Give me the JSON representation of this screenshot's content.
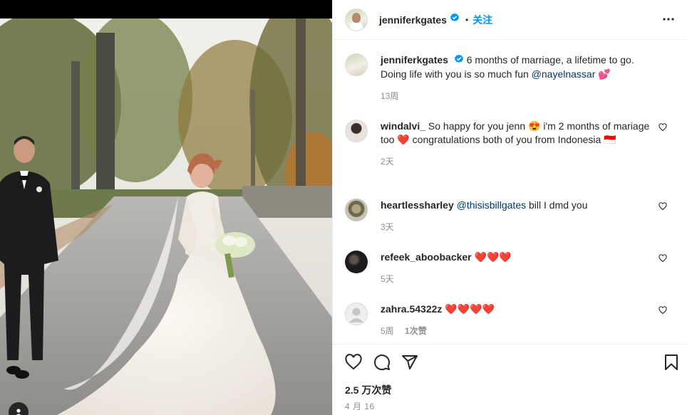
{
  "header": {
    "username": "jenniferkgates",
    "separator": "•",
    "follow_label": "关注"
  },
  "caption": {
    "username": "jenniferkgates",
    "text": "6 months of marriage, a lifetime to go. Doing life with you is so much fun ",
    "mention": "@nayelnassar",
    "emoji": "💕",
    "time": "13周"
  },
  "comments": [
    {
      "username": "windalvi_",
      "text": "So happy for you jenn 😍 i'm 2 months of mariage too ❤️ congratulations both of you from Indonesia 🇮🇩",
      "mention": "",
      "time": "2天",
      "likes": ""
    },
    {
      "username": "heartlessharley",
      "mention": "@thisisbillgates",
      "text": " bill I dmd you",
      "time": "3天",
      "likes": ""
    },
    {
      "username": "refeek_aboobacker",
      "mention": "",
      "text": "❤️❤️❤️",
      "time": "5天",
      "likes": ""
    },
    {
      "username": "zahra.54322z",
      "mention": "",
      "text": "❤️❤️❤️❤️",
      "time": "5周",
      "likes": "1次赞"
    }
  ],
  "footer": {
    "likes_total": "2.5 万次赞",
    "date": "4 月 16"
  },
  "icons": {
    "verified": "verified-badge-icon",
    "more": "more-options-icon",
    "like": "heart-icon",
    "comment": "comment-icon",
    "share": "share-icon",
    "save": "bookmark-icon",
    "tag": "user-tag-icon"
  },
  "colors": {
    "accent": "#0095f6",
    "mention": "#00376b",
    "muted": "#8e8e8e"
  }
}
